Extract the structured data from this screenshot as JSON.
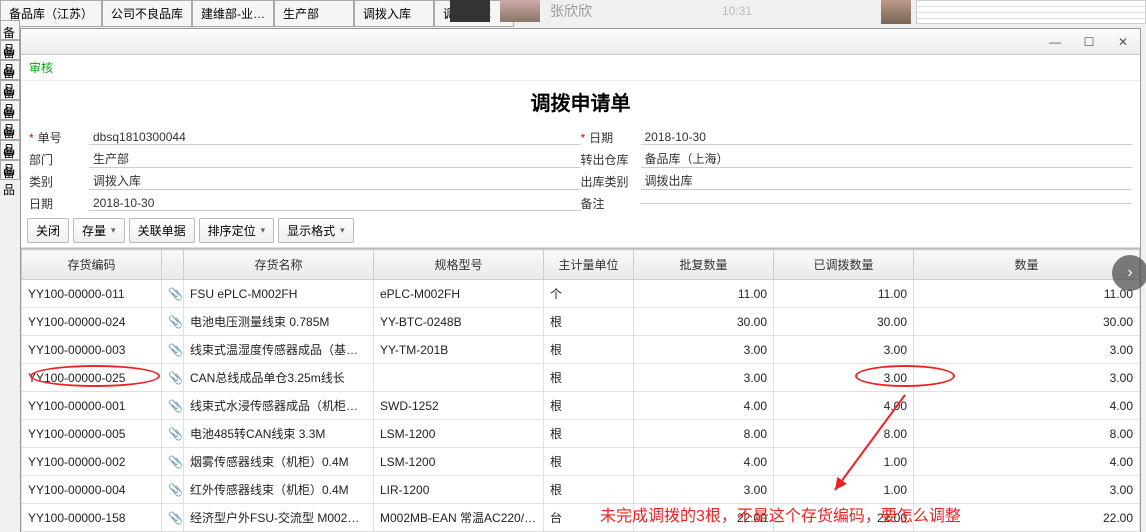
{
  "bg_tabs": [
    "备品库（江苏）",
    "公司不良品库",
    "建维部-业…",
    "生产部",
    "调拨入库",
    "调拨出库"
  ],
  "bg_side": [
    "备品",
    "备品",
    "备品",
    "备品",
    "备品",
    "备品",
    "备品",
    "备品"
  ],
  "taskbar_name": "张欣欣",
  "taskbar_time": "10:31",
  "window": {
    "min": "—",
    "max": "☐",
    "close": "✕",
    "approve": "审核",
    "title": "调拨申请单"
  },
  "header": {
    "l": [
      {
        "label": "单号",
        "req": true,
        "value": "dbsq1810300044"
      },
      {
        "label": "部门",
        "req": false,
        "value": "生产部"
      },
      {
        "label": "类别",
        "req": false,
        "value": "调拨入库"
      },
      {
        "label": "日期",
        "req": false,
        "value": "2018-10-30"
      }
    ],
    "r": [
      {
        "label": "日期",
        "req": true,
        "value": "2018-10-30"
      },
      {
        "label": "转出仓库",
        "req": false,
        "value": "备品库（上海）"
      },
      {
        "label": "出库类别",
        "req": false,
        "value": "调拨出库"
      },
      {
        "label": "备注",
        "req": false,
        "value": ""
      }
    ]
  },
  "toolbar": {
    "close": "关闭",
    "stock": "存量",
    "assoc": "关联单据",
    "sort": "排序定位",
    "format": "显示格式"
  },
  "cols": [
    "存货编码",
    "",
    "存货名称",
    "规格型号",
    "主计量单位",
    "批复数量",
    "已调拨数量",
    "数量"
  ],
  "rows": [
    {
      "code": "YY100-00000-011",
      "name": "FSU ePLC-M002FH",
      "spec": "ePLC-M002FH",
      "unit": "个",
      "qa": "11.00",
      "qb": "11.00",
      "qc": "11.00"
    },
    {
      "code": "YY100-00000-024",
      "name": "电池电压测量线束  0.785M",
      "spec": "YY-BTC-0248B",
      "unit": "根",
      "qa": "30.00",
      "qb": "30.00",
      "qc": "30.00"
    },
    {
      "code": "YY100-00000-003",
      "name": "线束式温湿度传感器成品（基…",
      "spec": "YY-TM-201B",
      "unit": "根",
      "qa": "3.00",
      "qb": "3.00",
      "qc": "3.00"
    },
    {
      "code": "YY100-00000-025",
      "name": "CAN总线成品单仓3.25m线长",
      "spec": "",
      "unit": "根",
      "qa": "3.00",
      "qb": "3.00",
      "qc": "3.00"
    },
    {
      "code": "YY100-00000-001",
      "name": "线束式水浸传感器成品（机柜…",
      "spec": "SWD-1252",
      "unit": "根",
      "qa": "4.00",
      "qb": "4.00",
      "qc": "4.00"
    },
    {
      "code": "YY100-00000-005",
      "name": "电池485转CAN线束  3.3M",
      "spec": "LSM-1200",
      "unit": "根",
      "qa": "8.00",
      "qb": "8.00",
      "qc": "8.00"
    },
    {
      "code": "YY100-00000-002",
      "name": "烟雾传感器线束（机柜）0.4M",
      "spec": "LSM-1200",
      "unit": "根",
      "qa": "4.00",
      "qb": "1.00",
      "qc": "4.00"
    },
    {
      "code": "YY100-00000-004",
      "name": "红外传感器线束（机柜）0.4M",
      "spec": "LIR-1200",
      "unit": "根",
      "qa": "3.00",
      "qb": "1.00",
      "qc": "3.00"
    },
    {
      "code": "YY100-00000-158",
      "name": "经济型户外FSU-交流型 M002…",
      "spec": "M002MB-EAN 常温AC220/D…",
      "unit": "台",
      "qa": "22.00",
      "qb": "22.00",
      "qc": "22.00"
    }
  ],
  "note": "未完成调拨的3根，不是这个存货编码，要怎么调整",
  "scroll_hint": "›"
}
